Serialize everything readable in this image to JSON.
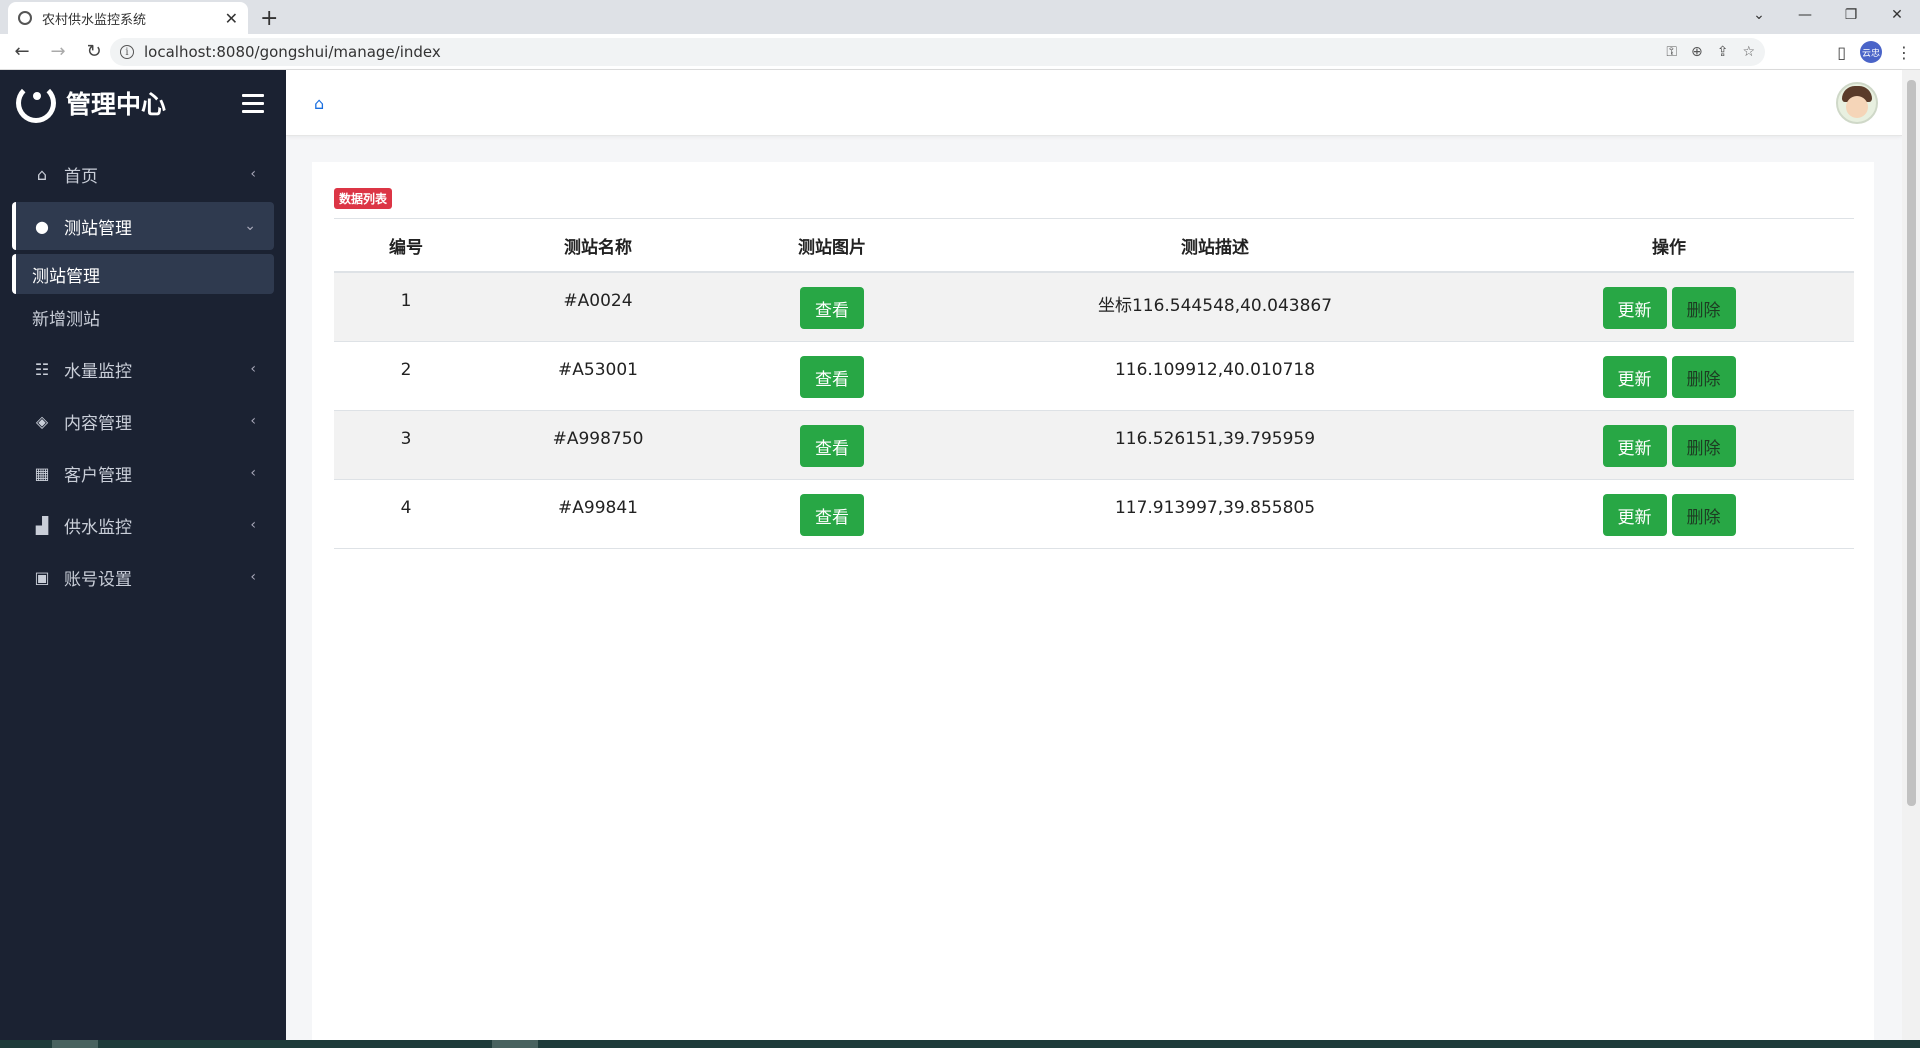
{
  "browser": {
    "tab_title": "农村供水监控系统",
    "url": "localhost:8080/gongshui/manage/index",
    "profile_label": "云忠"
  },
  "sidebar": {
    "brand": "管理中心",
    "items": [
      {
        "label": "首页",
        "icon": "home-icon"
      },
      {
        "label": "测站管理",
        "icon": "water-drop-icon",
        "active": true
      },
      {
        "label": "水量监控",
        "icon": "users-icon"
      },
      {
        "label": "内容管理",
        "icon": "tags-icon"
      },
      {
        "label": "客户管理",
        "icon": "grid-icon"
      },
      {
        "label": "供水监控",
        "icon": "bar-chart-icon"
      },
      {
        "label": "账号设置",
        "icon": "lock-icon"
      }
    ],
    "submenu": [
      {
        "label": "测站管理",
        "active": true
      },
      {
        "label": "新增测站"
      }
    ]
  },
  "main": {
    "badge": "数据列表",
    "table": {
      "headers": [
        "编号",
        "测站名称",
        "测站图片",
        "测站描述",
        "操作"
      ],
      "rows": [
        {
          "id": "1",
          "name": "#A0024",
          "view": "查看",
          "desc": "坐标116.544548,40.043867",
          "update": "更新",
          "delete": "删除"
        },
        {
          "id": "2",
          "name": "#A53001",
          "view": "查看",
          "desc": "116.109912,40.010718",
          "update": "更新",
          "delete": "删除"
        },
        {
          "id": "3",
          "name": "#A998750",
          "view": "查看",
          "desc": "116.526151,39.795959",
          "update": "更新",
          "delete": "删除"
        },
        {
          "id": "4",
          "name": "#A99841",
          "view": "查看",
          "desc": "117.913997,39.855805",
          "update": "更新",
          "delete": "删除"
        }
      ]
    }
  },
  "colors": {
    "sidebar_bg": "#1b2232",
    "active_bg": "#2f3a4f",
    "button_green": "#28a745",
    "badge_red": "#dc3545",
    "home_icon_blue": "#1a6fe0"
  }
}
